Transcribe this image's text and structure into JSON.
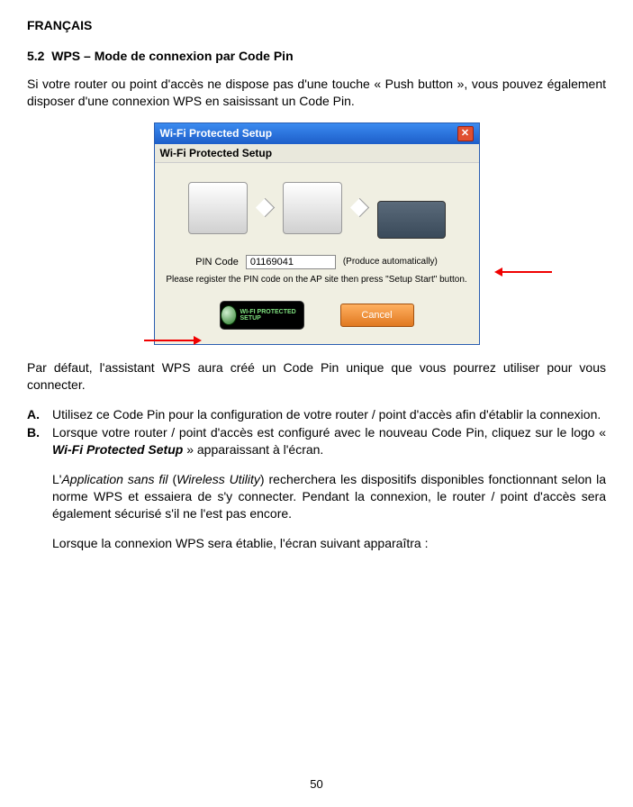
{
  "header": "FRANÇAIS",
  "section": {
    "number": "5.2",
    "title": "WPS – Mode de connexion par Code Pin"
  },
  "intro": "Si votre router ou point d'accès ne dispose pas d'une touche « Push button », vous pouvez également disposer d'une connexion WPS en saisissant un Code Pin.",
  "window": {
    "titlebar": "Wi-Fi Protected Setup",
    "inner_title": "Wi-Fi Protected Setup",
    "pin_label": "PIN Code",
    "pin_value": "01169041",
    "auto_text": "(Produce automatically)",
    "instruction": "Please register the PIN code on the AP site then press \"Setup Start\" button.",
    "wps_button_text": "WI-FI PROTECTED SETUP",
    "cancel": "Cancel",
    "close_x": "✕"
  },
  "after_figure": "Par défaut, l'assistant WPS aura créé un Code Pin unique que vous pourrez utiliser pour vous connecter.",
  "steps": {
    "a_mark": "A.",
    "a_text": "Utilisez ce Code Pin pour la configuration de votre router / point d'accès afin d'établir la connexion.",
    "b_mark": "B.",
    "b_pre": "Lorsque votre router / point d'accès est configuré avec le nouveau Code Pin, cliquez sur le logo « ",
    "b_logo": "Wi-Fi Protected Setup",
    "b_post": " » apparaissant à l'écran."
  },
  "para2": {
    "pre": "L'",
    "app_fr": "Application sans fil",
    "open": " (",
    "app_en": "Wireless Utility",
    "close": ") ",
    "rest": "recherchera les dispositifs disponibles fonctionnant selon la norme WPS et essaiera de s'y connecter. Pendant la connexion, le router / point d'accès sera également sécurisé s'il ne l'est pas encore."
  },
  "para3": "Lorsque la connexion WPS sera établie, l'écran suivant apparaîtra :",
  "pagenum": "50"
}
